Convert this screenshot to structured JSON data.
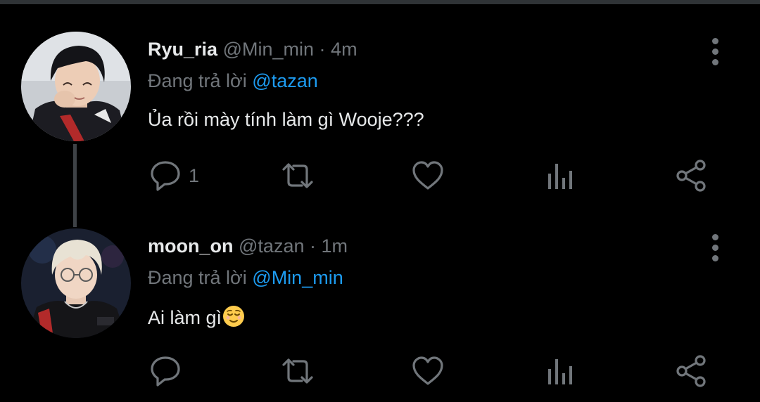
{
  "colors": {
    "background": "#000000",
    "primary_text": "#e7e9ea",
    "secondary_text": "#71767b",
    "mention": "#1d9bf0",
    "thread_line": "#3e4246"
  },
  "tweets": [
    {
      "display_name": "Ryu_ria",
      "handle": "@Min_min",
      "separator": "·",
      "time": "4m",
      "replying_prefix": "Đang trả lời",
      "replying_to": "@tazan",
      "text": "Ủa rồi mày tính làm gì Wooje???",
      "reply_count": "1",
      "icons": [
        "more-vertical-icon",
        "reply-icon",
        "retweet-icon",
        "like-icon",
        "analytics-icon",
        "share-icon"
      ]
    },
    {
      "display_name": "moon_on",
      "handle": "@tazan",
      "separator": "·",
      "time": "1m",
      "replying_prefix": "Đang trả lời",
      "replying_to": "@Min_min",
      "text": "Ai làm gì",
      "emoji": "relieved-face-emoji",
      "reply_count": "",
      "icons": [
        "more-vertical-icon",
        "reply-icon",
        "retweet-icon",
        "like-icon",
        "analytics-icon",
        "share-icon"
      ]
    }
  ]
}
